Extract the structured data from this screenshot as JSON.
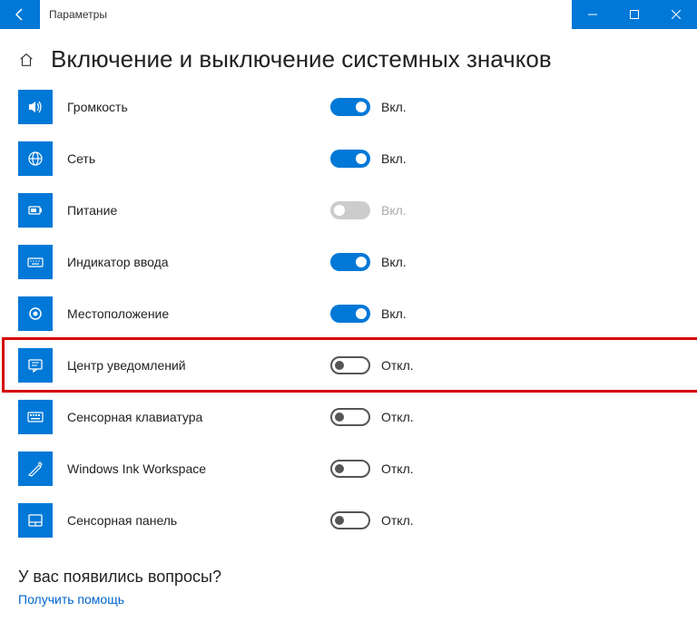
{
  "window": {
    "title": "Параметры"
  },
  "page": {
    "title": "Включение и выключение системных значков"
  },
  "state_labels": {
    "on": "Вкл.",
    "off": "Откл."
  },
  "items": [
    {
      "icon": "volume",
      "label": "Громкость",
      "state": "on"
    },
    {
      "icon": "network",
      "label": "Сеть",
      "state": "on"
    },
    {
      "icon": "power",
      "label": "Питание",
      "state": "disabled",
      "state_text": "Вкл."
    },
    {
      "icon": "input",
      "label": "Индикатор ввода",
      "state": "on"
    },
    {
      "icon": "location",
      "label": "Местоположение",
      "state": "on"
    },
    {
      "icon": "notification",
      "label": "Центр уведомлений",
      "state": "off",
      "highlight": true
    },
    {
      "icon": "touchkey",
      "label": "Сенсорная клавиатура",
      "state": "off"
    },
    {
      "icon": "ink",
      "label": "Windows Ink Workspace",
      "state": "off"
    },
    {
      "icon": "touchpad",
      "label": "Сенсорная панель",
      "state": "off"
    }
  ],
  "footer": {
    "question": "У вас появились вопросы?",
    "link": "Получить помощь"
  }
}
